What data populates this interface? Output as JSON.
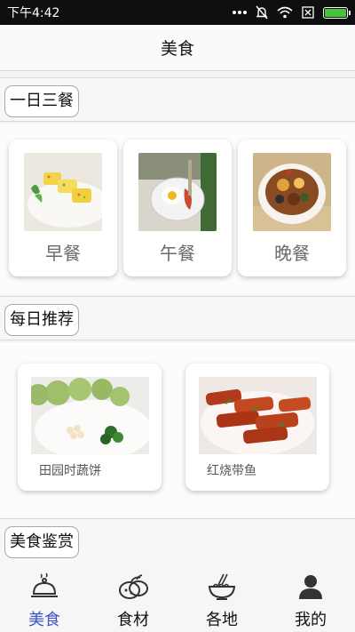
{
  "status_bar": {
    "time": "下午4:42",
    "icons": [
      "more-dots-icon",
      "mute-icon",
      "wifi-icon",
      "no-sim-icon",
      "battery-icon"
    ],
    "battery_color": "#46c33b"
  },
  "title_bar": {
    "title": "美食"
  },
  "sections": {
    "meals": {
      "title": "一日三餐"
    },
    "daily_recommend": {
      "title": "每日推荐"
    },
    "food_gallery": {
      "title": "美食鉴赏"
    }
  },
  "meals": [
    {
      "label": "早餐",
      "image": "breakfast-omelet-photo"
    },
    {
      "label": "午餐",
      "image": "lunch-egg-plate-photo"
    },
    {
      "label": "晚餐",
      "image": "dinner-stew-bowl-photo"
    }
  ],
  "recommendations": [
    {
      "label": "田园时蔬饼",
      "image": "vegetable-pancake-photo"
    },
    {
      "label": "红烧带鱼",
      "image": "braised-hairtail-photo"
    }
  ],
  "bottom_nav": {
    "active_color": "#3c52c8",
    "items": [
      {
        "label": "美食",
        "icon": "food-cloche-icon",
        "active": true
      },
      {
        "label": "食材",
        "icon": "ingredients-icon",
        "active": false
      },
      {
        "label": "各地",
        "icon": "noodle-bowl-icon",
        "active": false
      },
      {
        "label": "我的",
        "icon": "user-icon",
        "active": false
      }
    ]
  }
}
